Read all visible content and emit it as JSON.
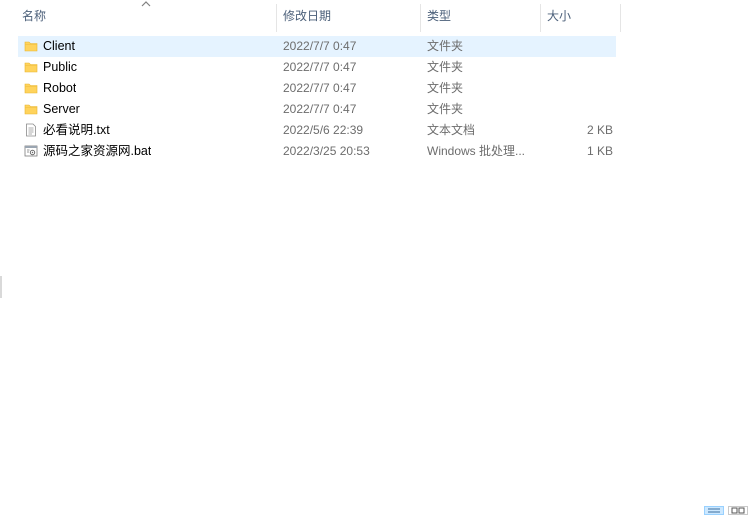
{
  "columns": {
    "name": "名称",
    "date": "修改日期",
    "type": "类型",
    "size": "大小"
  },
  "sort": {
    "column": "name",
    "direction": "ascending",
    "icon": "sort-up-chevron-icon"
  },
  "files": [
    {
      "name": "Client",
      "date": "2022/7/7 0:47",
      "type": "文件夹",
      "size": "",
      "icon": "folder-icon",
      "selected": true
    },
    {
      "name": "Public",
      "date": "2022/7/7 0:47",
      "type": "文件夹",
      "size": "",
      "icon": "folder-icon",
      "selected": false
    },
    {
      "name": "Robot",
      "date": "2022/7/7 0:47",
      "type": "文件夹",
      "size": "",
      "icon": "folder-icon",
      "selected": false
    },
    {
      "name": "Server",
      "date": "2022/7/7 0:47",
      "type": "文件夹",
      "size": "",
      "icon": "folder-icon",
      "selected": false
    },
    {
      "name": "必看说明.txt",
      "date": "2022/5/6 22:39",
      "type": "文本文档",
      "size": "2 KB",
      "icon": "text-file-icon",
      "selected": false
    },
    {
      "name": "源码之家资源网.bat",
      "date": "2022/3/25 20:53",
      "type": "Windows 批处理...",
      "size": "1 KB",
      "icon": "batch-file-icon",
      "selected": false
    }
  ],
  "view_buttons": [
    {
      "icon": "details-view-icon",
      "active": true
    },
    {
      "icon": "large-icons-view-icon",
      "active": false
    }
  ],
  "colors": {
    "selection": "#e5f3ff",
    "header_text": "#4c607a",
    "folder": "#ffd35c"
  }
}
